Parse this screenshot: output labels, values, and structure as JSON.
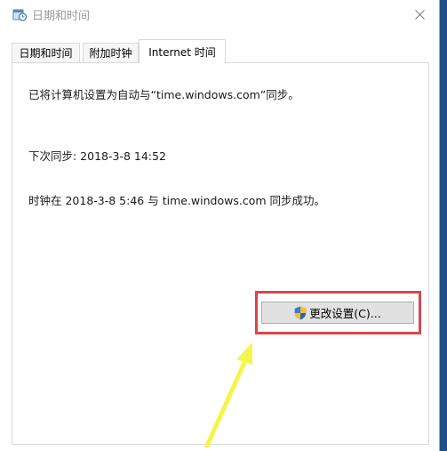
{
  "window": {
    "title": "日期和时间",
    "close_glyph": "✕"
  },
  "tabs": [
    {
      "label": "日期和时间"
    },
    {
      "label": "附加时钟"
    },
    {
      "label": "Internet 时间"
    }
  ],
  "content": {
    "sync_setting": "已将计算机设置为自动与“time.windows.com”同步。",
    "next_sync": "下次同步: 2018-3-8 14:52",
    "last_sync": "时钟在 2018-3-8 5:46 与 time.windows.com 同步成功。"
  },
  "buttons": {
    "change_settings": "更改设置(C)..."
  },
  "icons": {
    "app": "date-time-icon",
    "button": "uac-shield-icon"
  },
  "colors": {
    "highlight_box": "#d9464c",
    "annotation_arrow": "#f4f54a"
  }
}
